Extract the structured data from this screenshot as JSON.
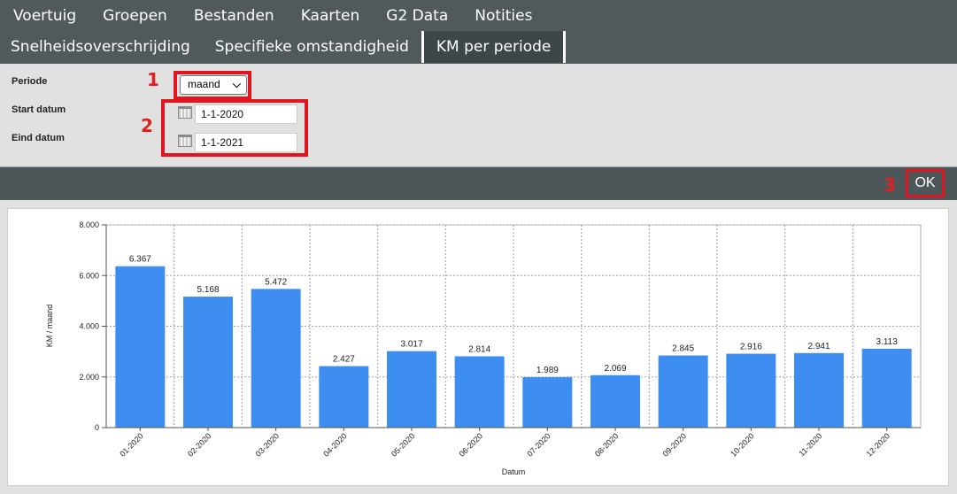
{
  "nav": {
    "row1": [
      "Voertuig",
      "Groepen",
      "Bestanden",
      "Kaarten",
      "G2 Data",
      "Notities"
    ],
    "row2": [
      "Snelheidsoverschrijding",
      "Specifieke omstandigheid",
      "KM per periode"
    ],
    "active": "KM per periode"
  },
  "form": {
    "periode_label": "Periode",
    "periode_value": "maand",
    "start_label": "Start datum",
    "start_value": "1-1-2020",
    "eind_label": "Eind datum",
    "eind_value": "1-1-2021"
  },
  "annotations": {
    "n1": "1",
    "n2": "2",
    "n3": "3",
    "highlight_color": "#e3141e"
  },
  "ok_label": "OK",
  "chart_data": {
    "type": "bar",
    "categories": [
      "01-2020",
      "02-2020",
      "03-2020",
      "04-2020",
      "05-2020",
      "06-2020",
      "07-2020",
      "08-2020",
      "09-2020",
      "10-2020",
      "11-2020",
      "12-2020"
    ],
    "values": [
      6367,
      5168,
      5472,
      2427,
      3017,
      2814,
      1989,
      2069,
      2845,
      2916,
      2941,
      3113
    ],
    "value_labels": [
      "6.367",
      "5.168",
      "5.472",
      "2.427",
      "3.017",
      "2.814",
      "1.989",
      "2.069",
      "2.845",
      "2.916",
      "2.941",
      "3.113"
    ],
    "xlabel": "Datum",
    "ylabel": "KM / maand",
    "ylim": [
      0,
      8000
    ],
    "yticks": [
      0,
      2000,
      4000,
      6000,
      8000
    ],
    "ytick_labels": [
      "0",
      "2.000",
      "4.000",
      "6.000",
      "8.000"
    ],
    "bar_color": "#3d8ef0",
    "grid": true
  }
}
